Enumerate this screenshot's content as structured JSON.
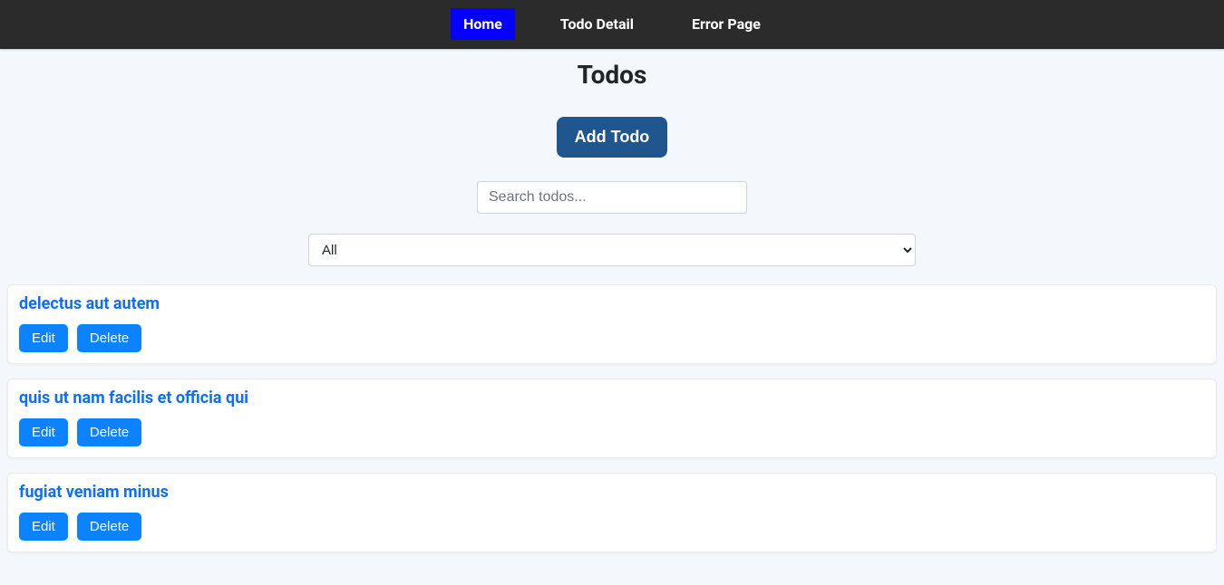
{
  "nav": {
    "home": "Home",
    "detail": "Todo Detail",
    "error": "Error Page"
  },
  "page": {
    "title": "Todos"
  },
  "actions": {
    "add_label": "Add Todo"
  },
  "search": {
    "placeholder": "Search todos..."
  },
  "filter": {
    "selected": "All"
  },
  "buttons": {
    "edit": "Edit",
    "delete": "Delete"
  },
  "todos": [
    {
      "title": "delectus aut autem"
    },
    {
      "title": "quis ut nam facilis et officia qui"
    },
    {
      "title": "fugiat veniam minus"
    }
  ]
}
